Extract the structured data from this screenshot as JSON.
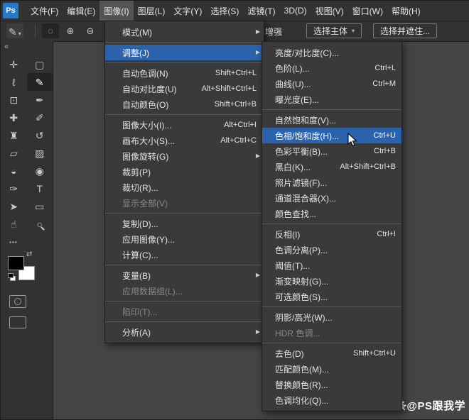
{
  "app": {
    "logo_text": "Ps"
  },
  "colors": {
    "canvas": "#454545",
    "panel": "#323232",
    "menu_bg": "#3a3a3a",
    "highlight": "#2a62ab",
    "logo_blue": "#2878c8",
    "disabled_text": "#8a8a8a"
  },
  "icons": {
    "submenu_arrow": "▶",
    "switch_colors": "⇄"
  },
  "menubar": {
    "items": [
      {
        "label": "文件(F)"
      },
      {
        "label": "编辑(E)"
      },
      {
        "label": "图像(I)",
        "active": true
      },
      {
        "label": "图层(L)"
      },
      {
        "label": "文字(Y)"
      },
      {
        "label": "选择(S)"
      },
      {
        "label": "滤镜(T)"
      },
      {
        "label": "3D(D)"
      },
      {
        "label": "视图(V)"
      },
      {
        "label": "窗口(W)"
      },
      {
        "label": "帮助(H)"
      }
    ]
  },
  "options_bar": {
    "tool_icon": "✎",
    "caret_icon": "▾",
    "mode_icons": [
      {
        "name": "selection-mode-new-icon",
        "glyph": "◌",
        "active": true
      },
      {
        "name": "selection-mode-add-icon",
        "glyph": "⊕"
      },
      {
        "name": "selection-mode-subtract-icon",
        "glyph": "⊖"
      }
    ],
    "auto_enhance_label": "增强",
    "select_subject_label": "选择主体",
    "select_and_mask_label": "选择并遮住..."
  },
  "image_menu": {
    "items": [
      {
        "label": "模式(M)",
        "submenu": true
      },
      {
        "sep": true
      },
      {
        "label": "调整(J)",
        "submenu": true,
        "highlight": true
      },
      {
        "sep": true
      },
      {
        "label": "自动色调(N)",
        "shortcut": "Shift+Ctrl+L"
      },
      {
        "label": "自动对比度(U)",
        "shortcut": "Alt+Shift+Ctrl+L"
      },
      {
        "label": "自动颜色(O)",
        "shortcut": "Shift+Ctrl+B"
      },
      {
        "sep": true
      },
      {
        "label": "图像大小(I)...",
        "shortcut": "Alt+Ctrl+I"
      },
      {
        "label": "画布大小(S)...",
        "shortcut": "Alt+Ctrl+C"
      },
      {
        "label": "图像旋转(G)",
        "submenu": true
      },
      {
        "label": "裁剪(P)"
      },
      {
        "label": "裁切(R)..."
      },
      {
        "label": "显示全部(V)",
        "disabled": true
      },
      {
        "sep": true
      },
      {
        "label": "复制(D)..."
      },
      {
        "label": "应用图像(Y)..."
      },
      {
        "label": "计算(C)..."
      },
      {
        "sep": true
      },
      {
        "label": "变量(B)",
        "submenu": true
      },
      {
        "label": "应用数据组(L)...",
        "disabled": true
      },
      {
        "sep": true
      },
      {
        "label": "陷印(T)...",
        "disabled": true
      },
      {
        "sep": true
      },
      {
        "label": "分析(A)",
        "submenu": true
      }
    ]
  },
  "adjustments_submenu": {
    "items": [
      {
        "label": "亮度/对比度(C)..."
      },
      {
        "label": "色阶(L)...",
        "shortcut": "Ctrl+L"
      },
      {
        "label": "曲线(U)...",
        "shortcut": "Ctrl+M"
      },
      {
        "label": "曝光度(E)..."
      },
      {
        "sep": true
      },
      {
        "label": "自然饱和度(V)..."
      },
      {
        "label": "色相/饱和度(H)...",
        "shortcut": "Ctrl+U",
        "highlight": true
      },
      {
        "label": "色彩平衡(B)...",
        "shortcut": "Ctrl+B"
      },
      {
        "label": "黑白(K)...",
        "shortcut": "Alt+Shift+Ctrl+B"
      },
      {
        "label": "照片滤镜(F)..."
      },
      {
        "label": "通道混合器(X)..."
      },
      {
        "label": "颜色查找..."
      },
      {
        "sep": true
      },
      {
        "label": "反相(I)",
        "shortcut": "Ctrl+I"
      },
      {
        "label": "色调分离(P)..."
      },
      {
        "label": "阈值(T)..."
      },
      {
        "label": "渐变映射(G)..."
      },
      {
        "label": "可选颜色(S)..."
      },
      {
        "sep": true
      },
      {
        "label": "阴影/高光(W)..."
      },
      {
        "label": "HDR 色调...",
        "disabled": true
      },
      {
        "sep": true
      },
      {
        "label": "去色(D)",
        "shortcut": "Shift+Ctrl+U"
      },
      {
        "label": "匹配颜色(M)..."
      },
      {
        "label": "替换颜色(R)..."
      },
      {
        "label": "色调均化(Q)..."
      }
    ]
  },
  "toolbar": {
    "collapse_glyph": "«",
    "edit_toolbar_glyph": "•••",
    "tools": [
      {
        "name": "move-tool",
        "glyph": "✛"
      },
      {
        "name": "marquee-tool",
        "glyph": "▢"
      },
      {
        "name": "lasso-tool",
        "glyph": "ℓ"
      },
      {
        "name": "quick-selection-tool",
        "glyph": "✎",
        "active": true
      },
      {
        "name": "crop-tool",
        "glyph": "⊡"
      },
      {
        "name": "eyedropper-tool",
        "glyph": "✒"
      },
      {
        "name": "healing-brush-tool",
        "glyph": "✚"
      },
      {
        "name": "brush-tool",
        "glyph": "✐"
      },
      {
        "name": "clone-stamp-tool",
        "glyph": "♜"
      },
      {
        "name": "history-brush-tool",
        "glyph": "↺"
      },
      {
        "name": "eraser-tool",
        "glyph": "▱"
      },
      {
        "name": "gradient-tool",
        "glyph": "▨"
      },
      {
        "name": "blur-tool",
        "glyph": "◒"
      },
      {
        "name": "dodge-tool",
        "glyph": "◉"
      },
      {
        "name": "pen-tool",
        "glyph": "✑"
      },
      {
        "name": "type-tool",
        "glyph": "T"
      },
      {
        "name": "path-selection-tool",
        "glyph": "➤"
      },
      {
        "name": "shape-tool",
        "glyph": "▭"
      },
      {
        "name": "hand-tool",
        "glyph": "☝"
      },
      {
        "name": "zoom-tool",
        "glyph": "○"
      }
    ]
  },
  "watermark": "头条@PS跟我学"
}
